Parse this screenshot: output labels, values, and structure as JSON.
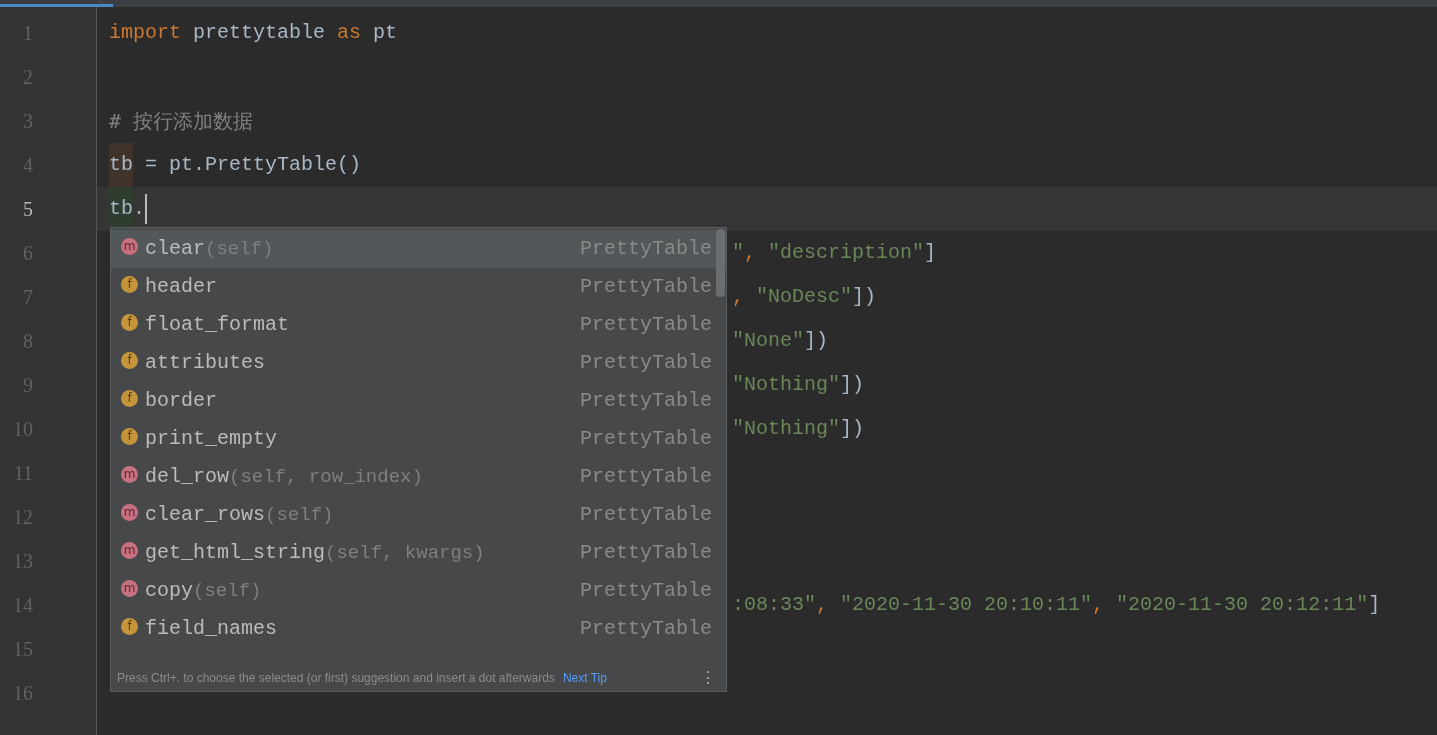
{
  "editor": {
    "lines": [
      {
        "number": "1",
        "current": false,
        "behind_popup": false,
        "segments": [
          {
            "kind": "keyword",
            "text": "import"
          },
          {
            "kind": "plain",
            "text": " prettytable "
          },
          {
            "kind": "keyword",
            "text": "as"
          },
          {
            "kind": "plain",
            "text": " pt"
          }
        ]
      },
      {
        "number": "2",
        "current": false
      },
      {
        "number": "3",
        "current": false,
        "behind_popup": false,
        "segments": [
          {
            "kind": "comment",
            "text": "# 按行添加数据"
          }
        ]
      },
      {
        "number": "4",
        "current": false,
        "behind_popup": false,
        "segments": [
          {
            "kind": "write_usage",
            "text": "tb"
          },
          {
            "kind": "plain",
            "text": " = pt.PrettyTable()"
          }
        ]
      },
      {
        "number": "5",
        "current": true,
        "behind_popup": false,
        "segments": [
          {
            "kind": "read_usage",
            "text": "tb"
          },
          {
            "kind": "plain",
            "text": "."
          }
        ]
      },
      {
        "number": "6",
        "current": false,
        "behind_popup": true,
        "segments": [
          {
            "kind": "string",
            "text": "\""
          },
          {
            "kind": "keyword",
            "text": ", "
          },
          {
            "kind": "string",
            "text": "\"description\""
          },
          {
            "kind": "plain",
            "text": "]"
          }
        ]
      },
      {
        "number": "7",
        "current": false,
        "behind_popup": true,
        "segments": [
          {
            "kind": "keyword",
            "text": ", "
          },
          {
            "kind": "string",
            "text": "\"NoDesc\""
          },
          {
            "kind": "plain",
            "text": "])"
          }
        ]
      },
      {
        "number": "8",
        "current": false,
        "behind_popup": true,
        "segments": [
          {
            "kind": "string",
            "text": "\"None\""
          },
          {
            "kind": "plain",
            "text": "])"
          }
        ]
      },
      {
        "number": "9",
        "current": false,
        "behind_popup": true,
        "segments": [
          {
            "kind": "string",
            "text": "\"Nothing\""
          },
          {
            "kind": "plain",
            "text": "])"
          }
        ]
      },
      {
        "number": "10",
        "current": false,
        "behind_popup": true,
        "segments": [
          {
            "kind": "string",
            "text": "\"Nothing\""
          },
          {
            "kind": "plain",
            "text": "])"
          }
        ]
      },
      {
        "number": "11",
        "current": false
      },
      {
        "number": "12",
        "current": false
      },
      {
        "number": "13",
        "current": false
      },
      {
        "number": "14",
        "current": false,
        "behind_popup": true,
        "segments": [
          {
            "kind": "string",
            "text": ":08:33\""
          },
          {
            "kind": "keyword",
            "text": ", "
          },
          {
            "kind": "string",
            "text": "\"2020-11-30 20:10:11\""
          },
          {
            "kind": "keyword",
            "text": ", "
          },
          {
            "kind": "string",
            "text": "\"2020-11-30 20:12:11\""
          },
          {
            "kind": "plain",
            "text": "]"
          }
        ]
      },
      {
        "number": "15",
        "current": false
      },
      {
        "number": "16",
        "current": false
      }
    ]
  },
  "completion_popup": {
    "items": [
      {
        "kind": "method",
        "icon": "m",
        "name": "clear",
        "params": "(self)",
        "type": "PrettyTable",
        "selected": true
      },
      {
        "kind": "field",
        "icon": "f",
        "name": "header",
        "type": "PrettyTable",
        "selected": false
      },
      {
        "kind": "field",
        "icon": "f",
        "name": "float_format",
        "type": "PrettyTable",
        "selected": false
      },
      {
        "kind": "field",
        "icon": "f",
        "name": "attributes",
        "type": "PrettyTable",
        "selected": false
      },
      {
        "kind": "field",
        "icon": "f",
        "name": "border",
        "type": "PrettyTable",
        "selected": false
      },
      {
        "kind": "field",
        "icon": "f",
        "name": "print_empty",
        "type": "PrettyTable",
        "selected": false
      },
      {
        "kind": "method",
        "icon": "m",
        "name": "del_row",
        "params": "(self, row_index)",
        "type": "PrettyTable",
        "selected": false
      },
      {
        "kind": "method",
        "icon": "m",
        "name": "clear_rows",
        "params": "(self)",
        "type": "PrettyTable",
        "selected": false
      },
      {
        "kind": "method",
        "icon": "m",
        "name": "get_html_string",
        "params": "(self, kwargs)",
        "type": "PrettyTable",
        "selected": false
      },
      {
        "kind": "method",
        "icon": "m",
        "name": "copy",
        "params": "(self)",
        "type": "PrettyTable",
        "selected": false
      },
      {
        "kind": "field",
        "icon": "f",
        "name": "field_names",
        "type": "PrettyTable",
        "selected": false
      }
    ],
    "hint": "Press Ctrl+. to choose the selected (or first) suggestion and insert a dot afterwards",
    "link": "Next Tip",
    "menu_icon": "⋮"
  }
}
